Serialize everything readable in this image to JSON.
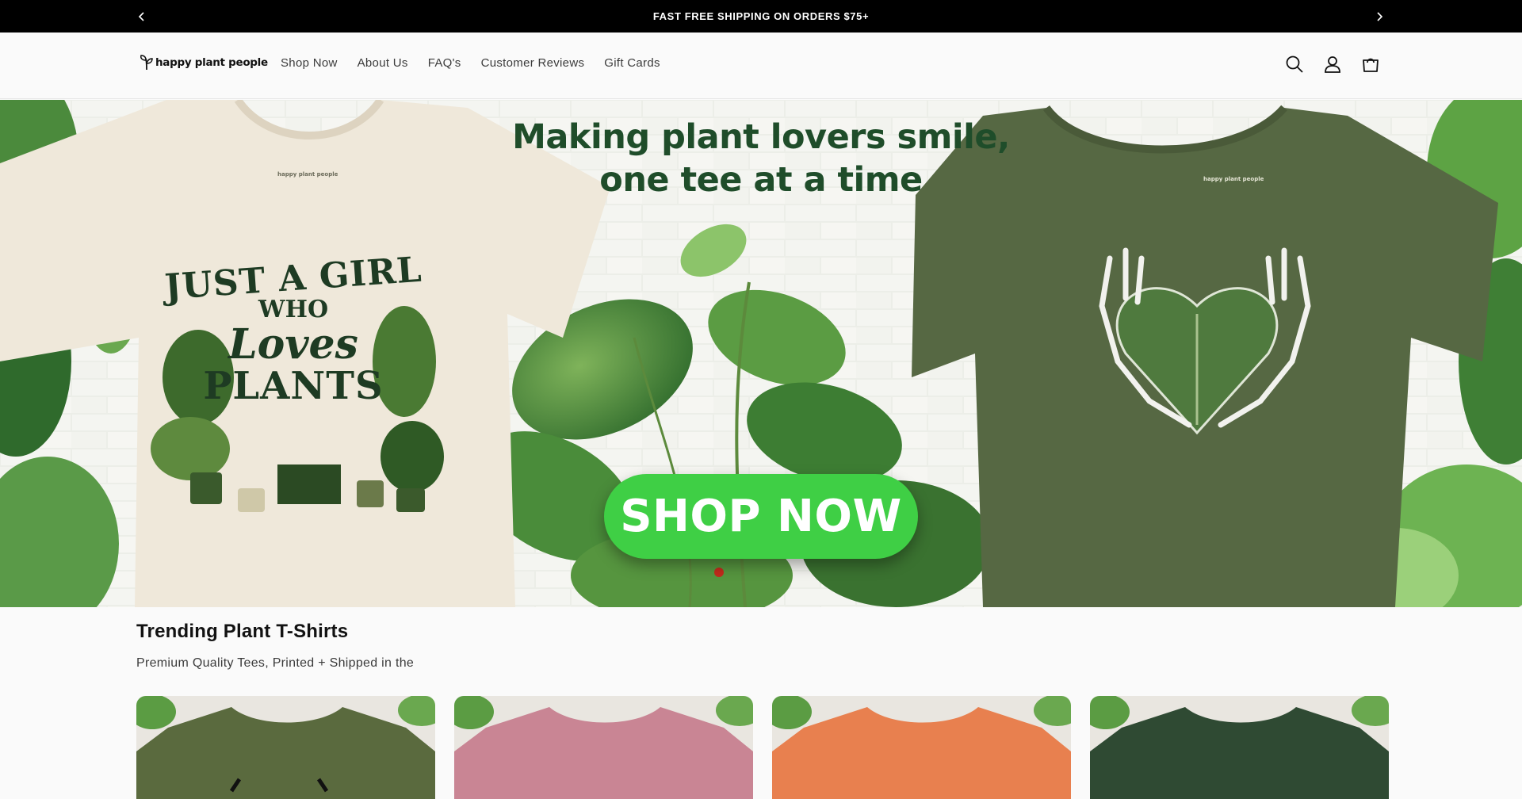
{
  "announcement": {
    "text": "FAST FREE SHIPPING ON ORDERS $75+",
    "prev_icon": "chevron-left-icon",
    "next_icon": "chevron-right-icon"
  },
  "header": {
    "logo_text": "happy plant people",
    "nav": [
      {
        "label": "Shop Now"
      },
      {
        "label": "About Us"
      },
      {
        "label": "FAQ's"
      },
      {
        "label": "Customer Reviews"
      },
      {
        "label": "Gift Cards"
      }
    ],
    "icons": [
      "search-icon",
      "account-icon",
      "cart-icon"
    ]
  },
  "hero": {
    "title_line1": "Making plant lovers smile,",
    "title_line2": "one tee at a time",
    "cta_label": "SHOP NOW",
    "shirt_left": {
      "line1": "JUST A GIRL",
      "line2": "WHO",
      "line3": "Loves",
      "line4": "PLANTS",
      "tag": "happy plant people"
    },
    "shirt_right": {
      "tag": "happy plant people"
    }
  },
  "trending": {
    "title": "Trending Plant T-Shirts",
    "subtitle": "Premium Quality Tees, Printed + Shipped in the",
    "cards": [
      {
        "color": "#5a6a3e"
      },
      {
        "color": "#c98594"
      },
      {
        "color": "#e8804f"
      },
      {
        "color": "#2f4a33"
      }
    ]
  },
  "colors": {
    "announce_bg": "#000000",
    "cta_green": "#3fcf45",
    "hero_title": "#1f4d2a",
    "left_shirt": "#efe8da",
    "right_shirt": "#566843"
  }
}
